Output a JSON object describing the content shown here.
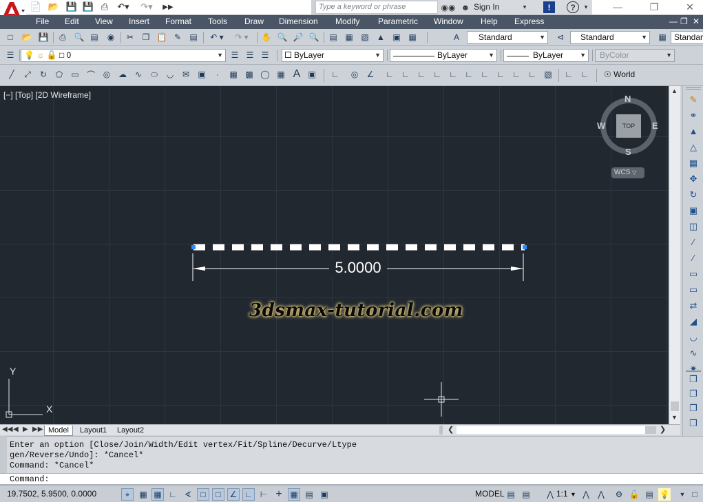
{
  "titlebar": {
    "search_placeholder": "Type a keyword or phrase",
    "sign_in": "Sign In",
    "help_icon": "?"
  },
  "menu": {
    "items": [
      "File",
      "Edit",
      "View",
      "Insert",
      "Format",
      "Tools",
      "Draw",
      "Dimension",
      "Modify",
      "Parametric",
      "Window",
      "Help",
      "Express"
    ]
  },
  "toolbar1": {
    "text_style": "Standard",
    "dim_style": "Standard",
    "table_style": "Standard"
  },
  "layers": {
    "current_layer": "0",
    "color": "ByLayer",
    "linetype": "ByLayer",
    "lineweight": "ByLayer",
    "plot_style": "ByColor"
  },
  "toolbar3": {
    "ucs": "World"
  },
  "viewport": {
    "label": "[−] [Top] [2D Wireframe]",
    "dimension_value": "5.0000",
    "watermark": "3dsmax-tutorial.com",
    "viewcube": {
      "n": "N",
      "s": "S",
      "e": "E",
      "w": "W",
      "face": "TOP",
      "wcs": "WCS"
    },
    "ucs_x": "X",
    "ucs_y": "Y"
  },
  "tabs": [
    "Model",
    "Layout1",
    "Layout2"
  ],
  "command": {
    "history": [
      "Enter an option [Close/Join/Width/Edit vertex/Fit/Spline/Decurve/Ltype",
      "gen/Reverse/Undo]: *Cancel*",
      "Command: *Cancel*"
    ],
    "prompt": "Command:"
  },
  "status": {
    "coordinates": "19.7502, 5.9500, 0.0000",
    "model": "MODEL",
    "scale": "1:1"
  }
}
